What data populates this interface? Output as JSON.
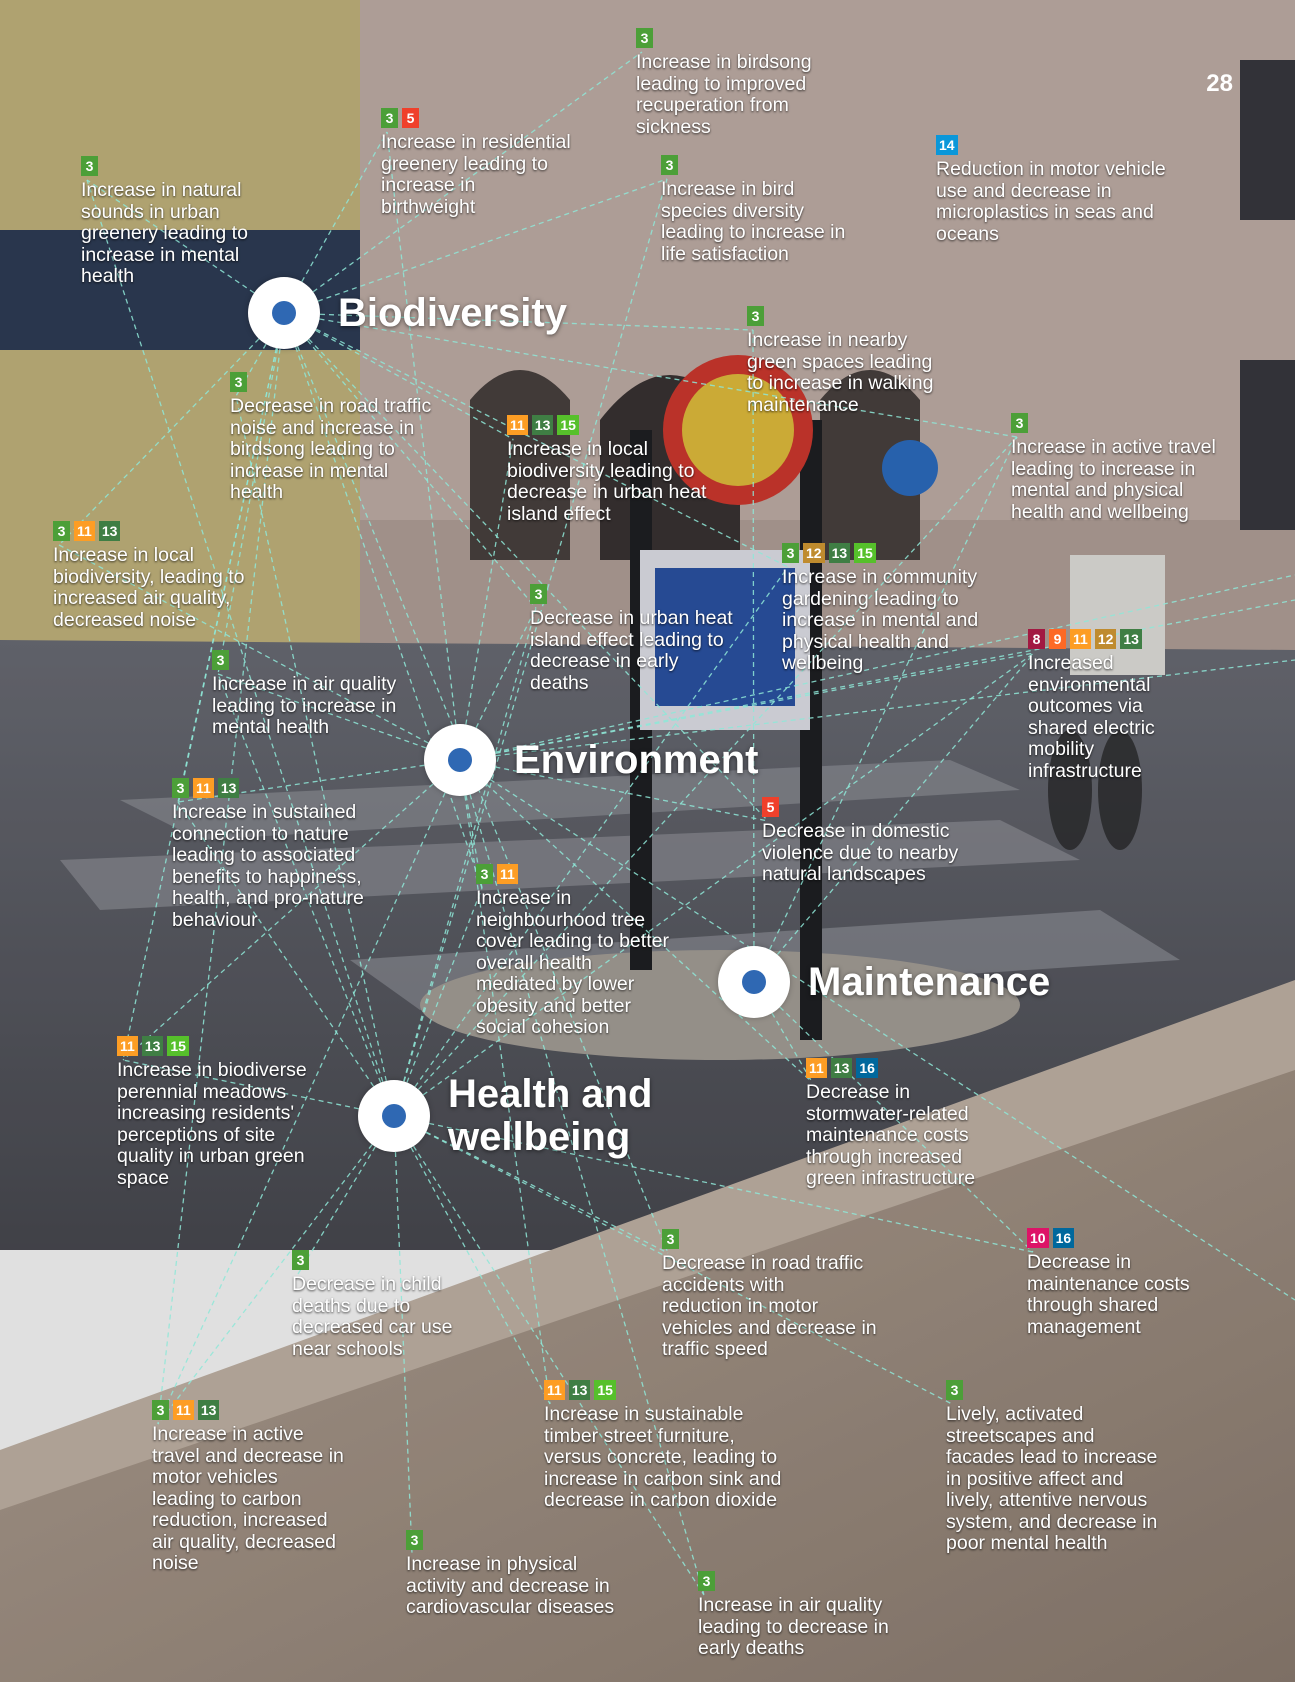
{
  "page_number": "28",
  "sdg_colors": {
    "3": "#4c9f38",
    "5": "#ef402b",
    "8": "#a21942",
    "9": "#fd6925",
    "10": "#dd1367",
    "11": "#fd9d24",
    "12": "#bf8b2e",
    "13": "#3f7e44",
    "14": "#0a97d9",
    "15": "#56c02b",
    "16": "#00689d"
  },
  "line_color": "#8fe8d8",
  "nodes": [
    {
      "id": "biodiversity",
      "label": "Biodiversity"
    },
    {
      "id": "environment",
      "label": "Environment"
    },
    {
      "id": "maintenance",
      "label": "Maintenance"
    },
    {
      "id": "health",
      "label": "Health and\nwellbeing"
    }
  ],
  "outcomes": [
    {
      "id": "o1",
      "tags": [
        "3"
      ],
      "text": "Increase in birdsong\nleading to improved\nrecuperation from\nsickness"
    },
    {
      "id": "o2",
      "tags": [
        "3",
        "5"
      ],
      "text": "Increase in residential\ngreenery leading to\nincrease in\nbirthweight"
    },
    {
      "id": "o3",
      "tags": [
        "3"
      ],
      "text": "Increase in natural\nsounds in urban\ngreenery leading to\nincrease in mental\nhealth"
    },
    {
      "id": "o4",
      "tags": [
        "3"
      ],
      "text": "Increase in bird\nspecies diversity\nleading to increase in\nlife satisfaction"
    },
    {
      "id": "o5",
      "tags": [
        "14"
      ],
      "text": "Reduction in motor vehicle\nuse and decrease in\nmicroplastics in seas and\noceans"
    },
    {
      "id": "o6",
      "tags": [
        "3"
      ],
      "text": "Increase in nearby\ngreen spaces leading\nto increase in walking\nmaintenance"
    },
    {
      "id": "o7",
      "tags": [
        "3"
      ],
      "text": "Decrease in road traffic\nnoise and increase in\nbirdsong leading to\nincrease in mental\nhealth"
    },
    {
      "id": "o8",
      "tags": [
        "11",
        "13",
        "15"
      ],
      "text": "Increase in local\nbiodiversity leading to\ndecrease in urban heat\nisland effect"
    },
    {
      "id": "o9",
      "tags": [
        "3"
      ],
      "text": "Increase in active travel\nleading to increase in\nmental and physical\nhealth and wellbeing"
    },
    {
      "id": "o10",
      "tags": [
        "3",
        "11",
        "13"
      ],
      "text": "Increase in local\nbiodiversity, leading to\nincreased air quality,\ndecreased noise"
    },
    {
      "id": "o11",
      "tags": [
        "3",
        "12",
        "13",
        "15"
      ],
      "text": "Increase in community\ngardening leading to\nincrease in mental and\nphysical health and\nwellbeing"
    },
    {
      "id": "o12",
      "tags": [
        "3"
      ],
      "text": "Decrease in urban heat\nisland effect leading to\ndecrease in early\ndeaths"
    },
    {
      "id": "o13",
      "tags": [
        "8",
        "9",
        "11",
        "12",
        "13"
      ],
      "text": "Increased\nenvironmental\noutcomes via\nshared electric\nmobility\ninfrastructure"
    },
    {
      "id": "o14",
      "tags": [
        "3"
      ],
      "text": "Increase in air quality\nleading to increase in\nmental health"
    },
    {
      "id": "o15",
      "tags": [
        "3",
        "11",
        "13"
      ],
      "text": "Increase in sustained\nconnection to nature\nleading to associated\nbenefits to happiness,\nhealth, and pro-nature\nbehaviour"
    },
    {
      "id": "o16",
      "tags": [
        "5"
      ],
      "text": "Decrease in domestic\nviolence due to nearby\nnatural landscapes"
    },
    {
      "id": "o17",
      "tags": [
        "3",
        "11"
      ],
      "text": "Increase in\nneighbourhood tree\ncover leading to better\noverall health\nmediated by lower\nobesity and better\nsocial cohesion"
    },
    {
      "id": "o18",
      "tags": [
        "11",
        "13",
        "15"
      ],
      "text": "Increase in biodiverse\nperennial meadows\nincreasing residents'\nperceptions of site\nquality in urban green\nspace"
    },
    {
      "id": "o19",
      "tags": [
        "11",
        "13",
        "16"
      ],
      "text": "Decrease in\nstormwater-related\nmaintenance costs\nthrough increased\ngreen infrastructure"
    },
    {
      "id": "o20",
      "tags": [
        "3"
      ],
      "text": "Decrease in child\ndeaths due to\ndecreased car use\nnear schools"
    },
    {
      "id": "o21",
      "tags": [
        "3"
      ],
      "text": "Decrease in road traffic\naccidents with\nreduction in motor\nvehicles and decrease in\ntraffic speed"
    },
    {
      "id": "o22",
      "tags": [
        "10",
        "16"
      ],
      "text": "Decrease in\nmaintenance costs\nthrough shared\nmanagement"
    },
    {
      "id": "o23",
      "tags": [
        "3",
        "11",
        "13"
      ],
      "text": "Increase in active\ntravel and decrease in\nmotor vehicles\nleading to carbon\nreduction, increased\nair quality, decreased\nnoise"
    },
    {
      "id": "o24",
      "tags": [
        "11",
        "13",
        "15"
      ],
      "text": "Increase in sustainable\ntimber street furniture,\nversus concrete, leading to\nincrease in carbon sink and\ndecrease in carbon dioxide"
    },
    {
      "id": "o25",
      "tags": [
        "3"
      ],
      "text": "Lively, activated\nstreetscapes and\nfacades lead to increase\nin positive affect and\nlively, attentive nervous\nsystem, and decrease in\npoor mental health"
    },
    {
      "id": "o26",
      "tags": [
        "3"
      ],
      "text": "Increase in physical\nactivity and decrease in\ncardiovascular diseases"
    },
    {
      "id": "o27",
      "tags": [
        "3"
      ],
      "text": "Increase in air quality\nleading to decrease in\nearly deaths"
    }
  ]
}
